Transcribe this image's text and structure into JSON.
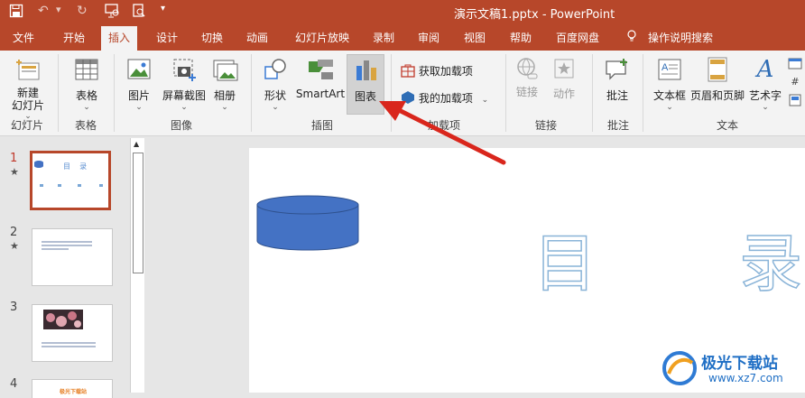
{
  "titlebar": {
    "title": "演示文稿1.pptx  -  PowerPoint"
  },
  "tabs": [
    "文件",
    "开始",
    "插入",
    "设计",
    "切换",
    "动画",
    "幻灯片放映",
    "录制",
    "审阅",
    "视图",
    "帮助",
    "百度网盘"
  ],
  "active_tab": "插入",
  "tell_me": "操作说明搜索",
  "ribbon": {
    "new_slide": "新建\n幻灯片",
    "table": "表格",
    "image": "图片",
    "screenshot": "屏幕截图",
    "album": "相册",
    "shapes": "形状",
    "smartart": "SmartArt",
    "chart": "图表",
    "get_addins": "获取加载项",
    "my_addins": "我的加载项",
    "link": "链接",
    "action": "动作",
    "comment": "批注",
    "textbox": "文本框",
    "header_footer": "页眉和页脚",
    "wordart": "艺术字"
  },
  "groups": {
    "slides": "幻灯片",
    "tables": "表格",
    "images": "图像",
    "illustrations": "插图",
    "addins": "加载项",
    "links": "链接",
    "comments": "批注",
    "text": "文本"
  },
  "slides": [
    {
      "num": "1",
      "star": "★"
    },
    {
      "num": "2",
      "star": "★"
    },
    {
      "num": "3",
      "star": ""
    },
    {
      "num": "4",
      "star": ""
    }
  ],
  "slide_content": {
    "char1": "目",
    "char2": "录"
  },
  "thumb1_title": "目    录",
  "thumb4_title": "极光下载站",
  "watermark": {
    "name": "极光下载站",
    "url": "www.xz7.com"
  },
  "colors": {
    "brand": "#b7472a",
    "shape_fill": "#4472c4",
    "arrow": "#d9261c"
  }
}
